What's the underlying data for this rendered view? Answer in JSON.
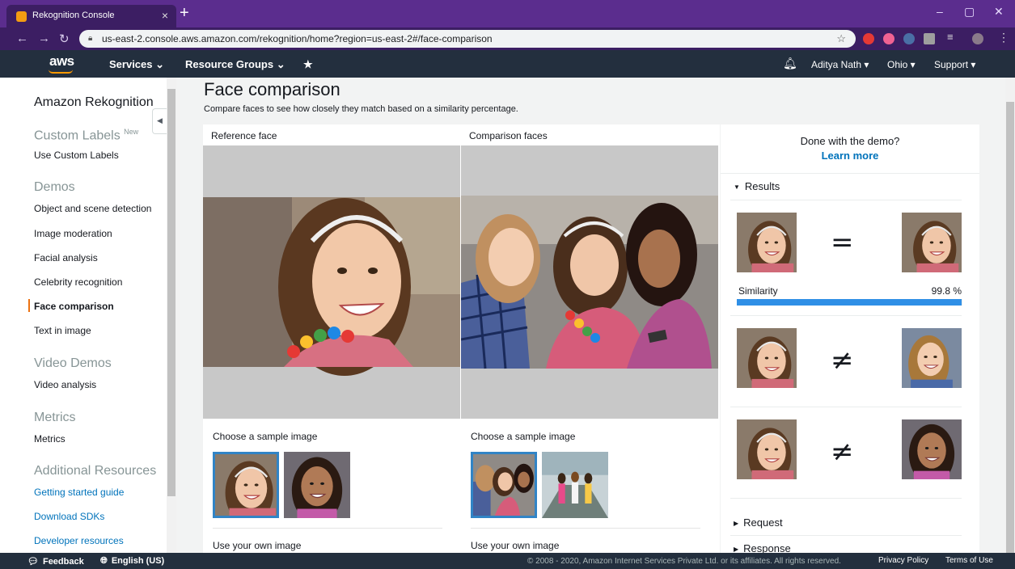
{
  "browser": {
    "tab_title": "Rekognition Console",
    "tab_close": "×",
    "new_tab": "+",
    "url": "us-east-2.console.aws.amazon.com/rekognition/home?region=us-east-2#/face-comparison",
    "minimize": "–",
    "maximize": "▢",
    "close": "✕"
  },
  "awsnav": {
    "logo": "aws",
    "services": "Services ⌄",
    "resource_groups": "Resource Groups ⌄",
    "pin": "★",
    "user": "Aditya Nath ▾",
    "region": "Ohio ▾",
    "support": "Support ▾"
  },
  "sidebar": {
    "title": "Amazon Rekognition",
    "custom_labels_heading": "Custom Labels",
    "new_badge": "New",
    "use_custom_labels": "Use Custom Labels",
    "demos_heading": "Demos",
    "demos": [
      "Object and scene detection",
      "Image moderation",
      "Facial analysis",
      "Celebrity recognition",
      "Face comparison",
      "Text in image"
    ],
    "video_demos_heading": "Video Demos",
    "video_analysis": "Video analysis",
    "metrics_heading": "Metrics",
    "metrics": "Metrics",
    "additional_heading": "Additional Resources",
    "resources": [
      "Getting started guide",
      "Download SDKs",
      "Developer resources"
    ]
  },
  "main": {
    "title": "Face comparison",
    "description": "Compare faces to see how closely they match based on a similarity percentage.",
    "reference_title": "Reference face",
    "comparison_title": "Comparison faces",
    "choose_sample": "Choose a sample image",
    "use_own": "Use your own image"
  },
  "results": {
    "done": "Done with the demo?",
    "learn_more": "Learn more",
    "heading": "Results",
    "equal_symbol": "=",
    "notequal_symbol": "≠",
    "similarity_label": "Similarity",
    "similarity_value": "99.8 %",
    "similarity_fraction": 0.998,
    "request": "Request",
    "response": "Response"
  },
  "footer": {
    "feedback": "Feedback",
    "language": "English (US)",
    "copyright": "© 2008 - 2020, Amazon Internet Services Private Ltd. or its affiliates. All rights reserved.",
    "privacy": "Privacy Policy",
    "terms": "Terms of Use"
  },
  "colors": {
    "aws_orange": "#ff9900",
    "aws_nav": "#232f3e",
    "link_blue": "#0073bb",
    "similarity_blue": "#2f8fe6",
    "browser_purple": "#5b2d8e"
  }
}
